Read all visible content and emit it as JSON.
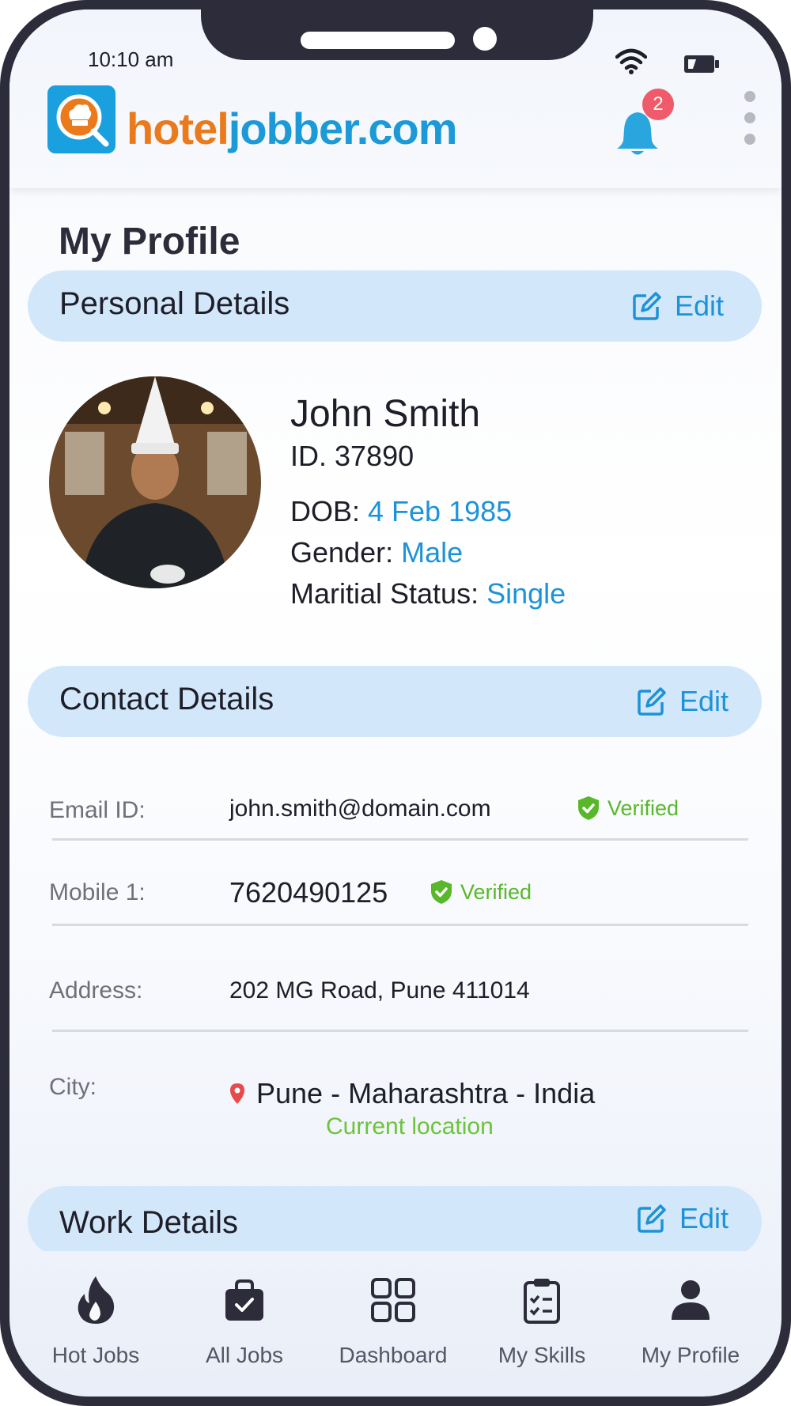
{
  "status_bar": {
    "time": "10:10 am",
    "icons": [
      "wifi-icon",
      "battery-icon"
    ]
  },
  "app_bar": {
    "logo_part1": "hotel",
    "logo_part2": "jobber.com",
    "notification_count": "2",
    "icons": [
      "chef-search-logo",
      "bell-icon",
      "kebab-menu-icon"
    ]
  },
  "page": {
    "title": "My Profile"
  },
  "personal": {
    "section_title": "Personal Details",
    "edit_label": "Edit",
    "name": "John Smith",
    "id_text": "ID. 37890",
    "dob_label": "DOB: ",
    "dob_value": "4 Feb 1985",
    "gender_label": "Gender: ",
    "gender_value": "Male",
    "marital_label": "Maritial Status: ",
    "marital_value": "Single"
  },
  "contact": {
    "section_title": "Contact Details",
    "edit_label": "Edit",
    "email_label": "Email ID:",
    "email_value": "john.smith@domain.com",
    "email_status": "Verified",
    "mobile_label": "Mobile 1:",
    "mobile_value": "7620490125",
    "mobile_status": "Verified",
    "address_label": "Address:",
    "address_value": "202 MG Road, Pune 411014",
    "city_label": "City:",
    "city_value": "Pune - Maharashtra - India",
    "city_note": "Current location"
  },
  "work": {
    "section_title": "Work Details",
    "edit_label": "Edit"
  },
  "bottom_nav": [
    {
      "label": "Hot Jobs",
      "icon": "fire-icon"
    },
    {
      "label": "All Jobs",
      "icon": "briefcase-check-icon"
    },
    {
      "label": "Dashboard",
      "icon": "grid-icon"
    },
    {
      "label": "My Skills",
      "icon": "clipboard-check-icon"
    },
    {
      "label": "My Profile",
      "icon": "user-icon"
    }
  ],
  "colors": {
    "accent": "#1c93d8",
    "section_bg": "#d3e7fb",
    "verified": "#58b82a",
    "logo_orange": "#ea7a1c",
    "badge": "#ef5b6a"
  }
}
